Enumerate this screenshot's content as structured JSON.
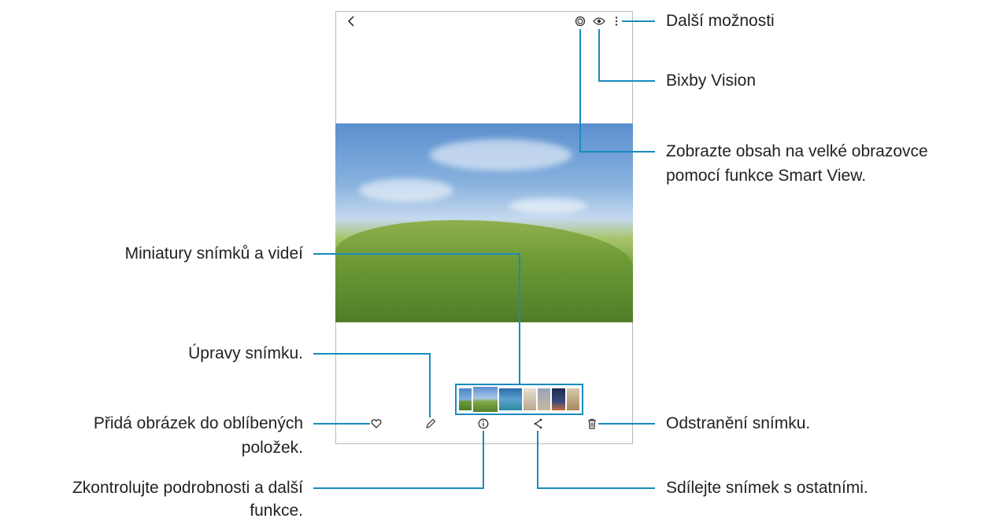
{
  "labels": {
    "more_options": "Další možnosti",
    "bixby_vision": "Bixby Vision",
    "smart_view_line1": "Zobrazte obsah na velké obrazovce",
    "smart_view_line2": "pomocí funkce Smart View.",
    "thumbnails": "Miniatury snímků a videí",
    "edit": "Úpravy snímku.",
    "favorite_line1": "Přidá obrázek do oblíbených",
    "favorite_line2": "položek.",
    "delete": "Odstranění snímku.",
    "details_line1": "Zkontrolujte podrobnosti a další",
    "details_line2": "funkce.",
    "share": "Sdílejte snímek s ostatními."
  },
  "icons": {
    "back": "chevron-left-icon",
    "smart_view": "smart-view-icon",
    "bixby": "eye-icon",
    "more": "more-vertical-icon",
    "favorite": "heart-icon",
    "edit": "pencil-icon",
    "details": "info-icon",
    "share": "share-icon",
    "delete": "trash-icon"
  },
  "colors": {
    "callout_line": "#1a8bbd",
    "frame": "#b9b9b9"
  }
}
